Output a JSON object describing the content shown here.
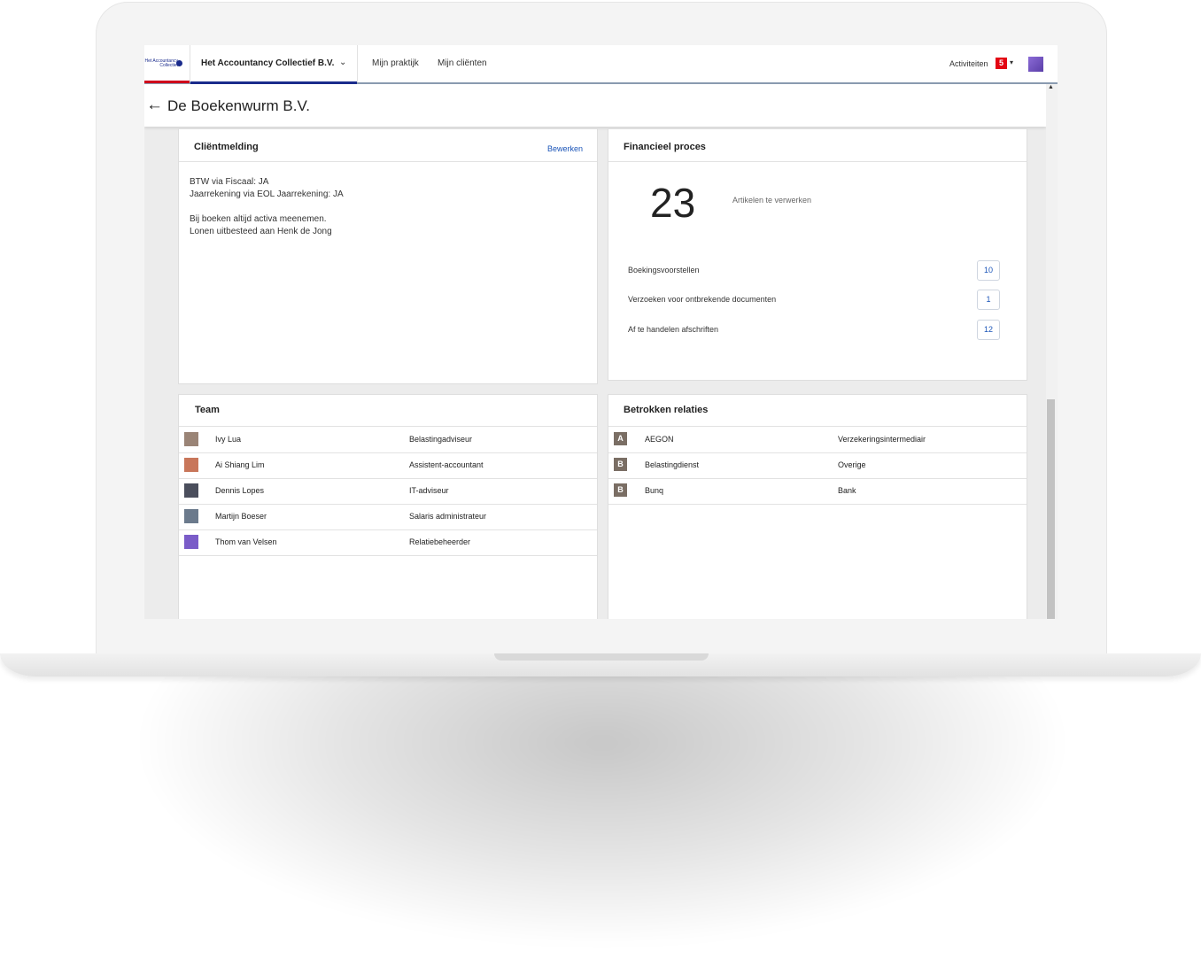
{
  "header": {
    "logo_text": "Het Accountancy Collectief",
    "org_name": "Het Accountancy Collectief B.V.",
    "nav": [
      "Mijn praktijk",
      "Mijn cliënten"
    ],
    "activity_label": "Activiteiten",
    "activity_count": "5"
  },
  "page": {
    "back_arrow": "←",
    "title": "De Boekenwurm B.V."
  },
  "client_note": {
    "title": "Cliëntmelding",
    "edit_label": "Bewerken",
    "lines": [
      "BTW via Fiscaal: JA",
      "Jaarrekening via EOL Jaarrekening: JA",
      "Bij boeken altijd activa meenemen.",
      "Lonen uitbesteed aan Henk de Jong"
    ]
  },
  "financial": {
    "title": "Financieel proces",
    "total": "23",
    "total_label": "Artikelen te verwerken",
    "items": [
      {
        "label": "Boekingsvoorstellen",
        "count": "10"
      },
      {
        "label": "Verzoeken voor ontbrekende documenten",
        "count": "1"
      },
      {
        "label": "Af te handelen afschriften",
        "count": "12"
      }
    ]
  },
  "team": {
    "title": "Team",
    "members": [
      {
        "name": "Ivy Lua",
        "role": "Belastingadviseur",
        "avatar_color": "#9a8476"
      },
      {
        "name": "Ai Shiang Lim",
        "role": "Assistent-accountant",
        "avatar_color": "#c8765a"
      },
      {
        "name": "Dennis Lopes",
        "role": "IT-adviseur",
        "avatar_color": "#4a4e5c"
      },
      {
        "name": "Martijn Boeser",
        "role": "Salaris administrateur",
        "avatar_color": "#6b7a8c"
      },
      {
        "name": "Thom van Velsen",
        "role": "Relatiebeheerder",
        "avatar_color": "#7a5cc8"
      }
    ]
  },
  "relations": {
    "title": "Betrokken relaties",
    "items": [
      {
        "badge": "A",
        "name": "AEGON",
        "type": "Verzekeringsintermediair"
      },
      {
        "badge": "B",
        "name": "Belastingdienst",
        "type": "Overige"
      },
      {
        "badge": "B",
        "name": "Bunq",
        "type": "Bank"
      }
    ]
  },
  "icons": {
    "chevron": "⌄",
    "caret": "▾",
    "scroll_up": "▲"
  },
  "colors": {
    "brand_blue": "#1a2b8c",
    "brand_red": "#d0021b",
    "badge_red": "#e30613",
    "link_blue": "#1a54b8"
  }
}
